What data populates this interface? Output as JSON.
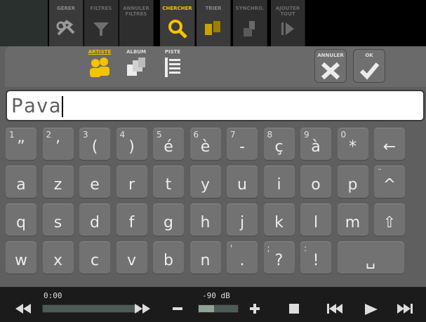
{
  "toolbar": {
    "buttons": [
      {
        "label": "GÉRER",
        "icon": "manage-icon",
        "state": "normal"
      },
      {
        "label": "FILTRES",
        "icon": "filter-icon",
        "state": "dim"
      },
      {
        "label": "ANNULER FILTRES",
        "icon": "",
        "state": "dim"
      },
      {
        "label": "CHERCHER",
        "icon": "search-icon",
        "state": "active"
      },
      {
        "label": "TRIER",
        "icon": "sort-icon",
        "state": "normal"
      },
      {
        "label": "SYNCHRO.",
        "icon": "sync-icon",
        "state": "dim"
      },
      {
        "label": "AJOUTER TOUT",
        "icon": "add-all-icon",
        "state": "dim"
      }
    ]
  },
  "search": {
    "modes": [
      {
        "label": "ARTISTE",
        "icon": "artist-icon",
        "active": true
      },
      {
        "label": "ALBUM",
        "icon": "album-icon",
        "active": false
      },
      {
        "label": "PISTE",
        "icon": "track-icon",
        "active": false
      }
    ],
    "cancel_label": "ANNULER",
    "ok_label": "OK",
    "query": "Pava"
  },
  "keyboard": {
    "row1": [
      {
        "sup": "1",
        "main": "”"
      },
      {
        "sup": "2",
        "main": "’"
      },
      {
        "sup": "3",
        "main": "("
      },
      {
        "sup": "4",
        "main": ")"
      },
      {
        "sup": "5",
        "main": "é"
      },
      {
        "sup": "6",
        "main": "è"
      },
      {
        "sup": "7",
        "main": "-"
      },
      {
        "sup": "8",
        "main": "ç"
      },
      {
        "sup": "9",
        "main": "à"
      },
      {
        "sup": "0",
        "main": "*"
      },
      {
        "sup": "",
        "main": "←"
      }
    ],
    "row2": [
      {
        "sup": "",
        "main": "a"
      },
      {
        "sup": "",
        "main": "z"
      },
      {
        "sup": "",
        "main": "e"
      },
      {
        "sup": "",
        "main": "r"
      },
      {
        "sup": "",
        "main": "t"
      },
      {
        "sup": "",
        "main": "y"
      },
      {
        "sup": "",
        "main": "u"
      },
      {
        "sup": "",
        "main": "i"
      },
      {
        "sup": "",
        "main": "o"
      },
      {
        "sup": "",
        "main": "p"
      },
      {
        "sup": "¨",
        "main": "^"
      }
    ],
    "row3": [
      {
        "sup": "",
        "main": "q"
      },
      {
        "sup": "",
        "main": "s"
      },
      {
        "sup": "",
        "main": "d"
      },
      {
        "sup": "",
        "main": "f"
      },
      {
        "sup": "",
        "main": "g"
      },
      {
        "sup": "",
        "main": "h"
      },
      {
        "sup": "",
        "main": "j"
      },
      {
        "sup": "",
        "main": "k"
      },
      {
        "sup": "",
        "main": "l"
      },
      {
        "sup": "",
        "main": "m"
      },
      {
        "sup": "",
        "main": "⇧"
      }
    ],
    "row4": [
      {
        "sup": "",
        "main": "w"
      },
      {
        "sup": "",
        "main": "x"
      },
      {
        "sup": "",
        "main": "c"
      },
      {
        "sup": "",
        "main": "v"
      },
      {
        "sup": "",
        "main": "b"
      },
      {
        "sup": "",
        "main": "n"
      },
      {
        "sup": "'",
        "main": "."
      },
      {
        "sup": ";",
        "main": "?"
      },
      {
        "sup": ":",
        "main": "!"
      },
      {
        "sup": "",
        "main": "␣"
      }
    ]
  },
  "player": {
    "time": "0:00",
    "progress": 0,
    "volume_label": "-90 dB",
    "volume_level": 0.4
  },
  "colors": {
    "accent": "#f5c400",
    "panel": "#5f5f5f",
    "key": "#727272"
  }
}
